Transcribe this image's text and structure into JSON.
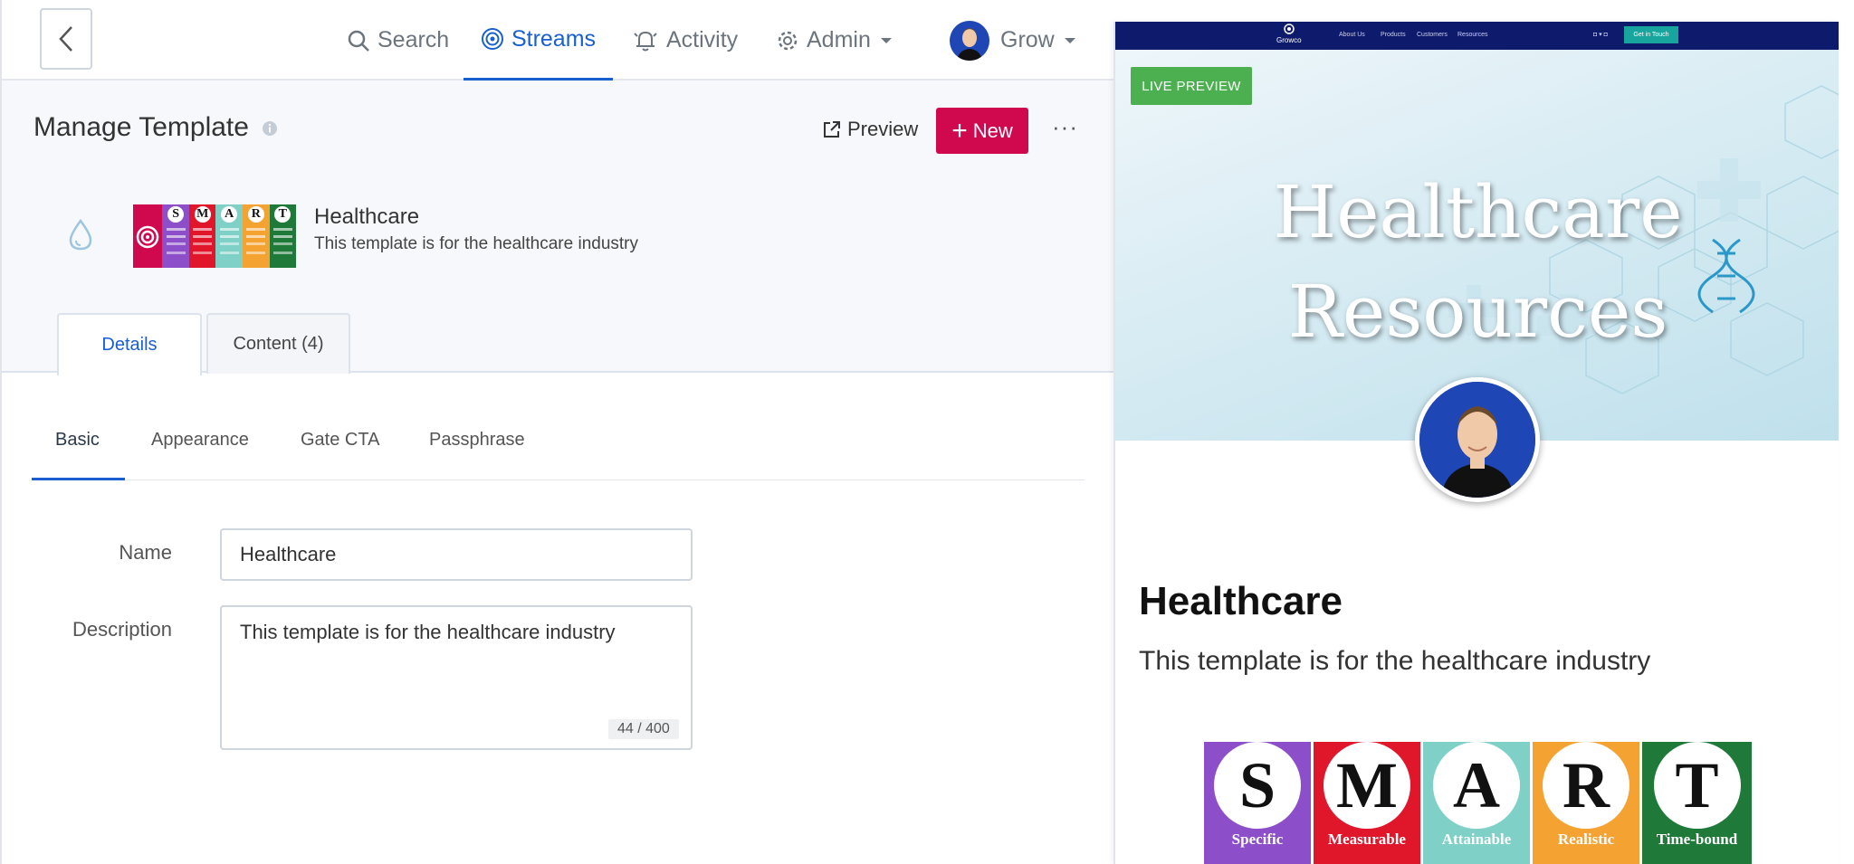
{
  "nav": {
    "search": "Search",
    "streams": "Streams",
    "activity": "Activity",
    "admin": "Admin",
    "user": "Grow",
    "accent": "#1a5fd0"
  },
  "header": {
    "title": "Manage Template",
    "preview_label": "Preview",
    "new_label": "New",
    "more_label": "···",
    "new_color": "#d0094e"
  },
  "template": {
    "name": "Healthcare",
    "description": "This template is for the healthcare industry",
    "thumbnail_letters": [
      "S",
      "M",
      "A",
      "R",
      "T"
    ]
  },
  "tabs": [
    {
      "label": "Details",
      "active": true
    },
    {
      "label": "Content (4)",
      "active": false
    }
  ],
  "subtabs": [
    {
      "label": "Basic",
      "active": true
    },
    {
      "label": "Appearance",
      "active": false
    },
    {
      "label": "Gate CTA",
      "active": false
    },
    {
      "label": "Passphrase",
      "active": false
    }
  ],
  "form": {
    "name_label": "Name",
    "name_value": "Healthcare",
    "desc_label": "Description",
    "desc_value": "This template is for the healthcare industry",
    "char_count": "44 / 400"
  },
  "preview": {
    "badge": "LIVE PREVIEW",
    "badge_color": "#4caf50",
    "site_logo": "Growco",
    "site_links": [
      "About Us",
      "Products",
      "Customers",
      "Resources"
    ],
    "site_cta": "Get in Touch",
    "hero_line1": "Healthcare",
    "hero_line2": "Resources",
    "title": "Healthcare",
    "description": "This template is for the healthcare industry",
    "smart": [
      {
        "letter": "S",
        "label": "Specific",
        "color": "#8c4fc9"
      },
      {
        "letter": "M",
        "label": "Measurable",
        "color": "#e0162b"
      },
      {
        "letter": "A",
        "label": "Attainable",
        "color": "#7fd1c8"
      },
      {
        "letter": "R",
        "label": "Realistic",
        "color": "#f4a232"
      },
      {
        "letter": "T",
        "label": "Time-bound",
        "color": "#1f7a3a"
      }
    ]
  }
}
